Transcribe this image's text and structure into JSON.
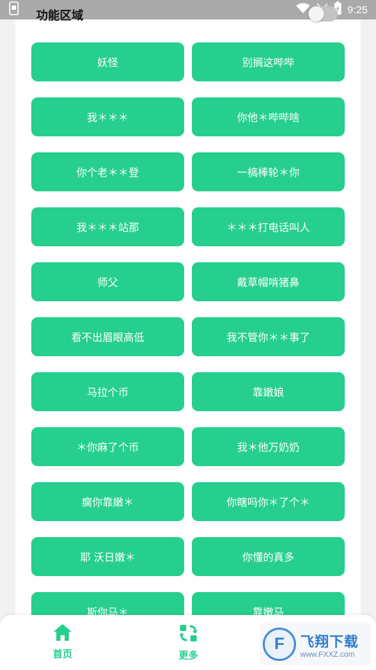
{
  "status_bar": {
    "time": "9:25",
    "icons": [
      "notification-icon",
      "wifi-icon",
      "signal-icon",
      "battery-icon"
    ]
  },
  "section": {
    "title": "功能区域",
    "toggle_on": false
  },
  "buttons": [
    "妖怪",
    "别搁这哔哔",
    "我＊＊＊",
    "你他＊哔哔啥",
    "你个老＊＊登",
    "一槁棒轮＊你",
    "我＊＊＊站那",
    "＊＊＊打电话叫人",
    "师父",
    "戴草帽啃猪鼻",
    "看不出眉眼高低",
    "我不管你＊＊事了",
    "马拉个币",
    "靠嫩娘",
    "＊你麻了个币",
    "我＊他万奶奶",
    "瘸你靠嫩＊",
    "你瞎吗你＊了个＊",
    "耶 沃日嫩＊",
    "你懂的真多",
    "斯你马＊",
    "靠嫩马"
  ],
  "bottom_nav": {
    "items": [
      {
        "label": "首页",
        "icon": "home-icon"
      },
      {
        "label": "更多",
        "icon": "refresh-icon"
      }
    ]
  },
  "watermark": {
    "title": "飞翔下载",
    "url": "www.FXXZ.com"
  },
  "colors": {
    "accent": "#26cf8d",
    "status_bar": "#a9aaa9",
    "background": "#f1f2f1"
  }
}
